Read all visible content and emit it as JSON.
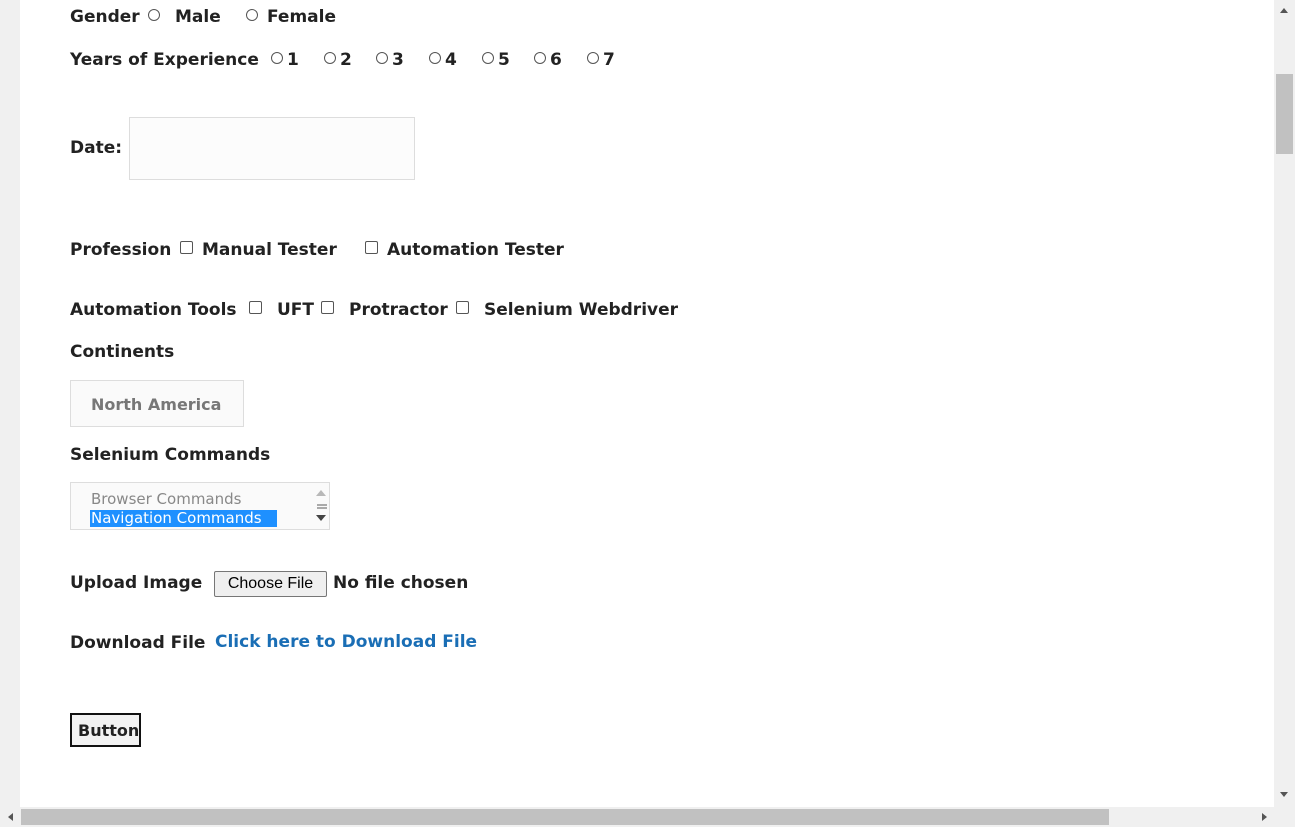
{
  "gender": {
    "label": "Gender",
    "options": [
      "Male",
      "Female"
    ]
  },
  "experience": {
    "label": "Years of Experience",
    "options": [
      "1",
      "2",
      "3",
      "4",
      "5",
      "6",
      "7"
    ]
  },
  "date": {
    "label": "Date:",
    "value": ""
  },
  "profession": {
    "label": "Profession",
    "options": [
      "Manual Tester",
      "Automation Tester"
    ]
  },
  "tools": {
    "label": "Automation Tools",
    "options": [
      "UFT",
      "Protractor",
      "Selenium Webdriver"
    ]
  },
  "continents": {
    "label": "Continents",
    "selected": "North America"
  },
  "commands": {
    "label": "Selenium Commands",
    "options": [
      "Browser Commands",
      "Navigation Commands"
    ],
    "selected": "Navigation Commands"
  },
  "upload": {
    "label": "Upload Image",
    "button": "Choose File",
    "status": "No file chosen"
  },
  "download": {
    "label": "Download File",
    "link": "Click here to Download File"
  },
  "button": {
    "label": "Button"
  },
  "colors": {
    "link": "#1a6eb5",
    "selection": "#1e90ff"
  }
}
